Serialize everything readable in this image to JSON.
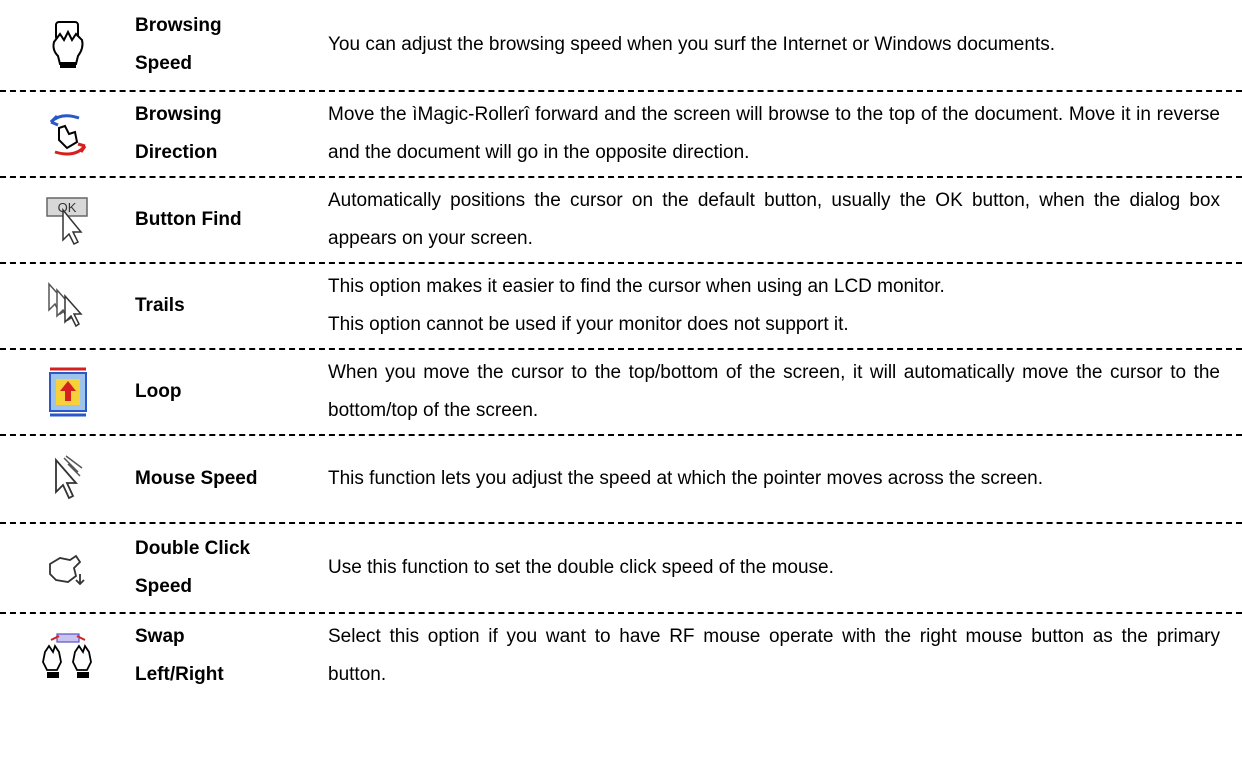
{
  "rows": [
    {
      "icon": "hand-scroll-icon",
      "name_lines": [
        "Browsing",
        "Speed"
      ],
      "description": [
        "You can adjust the browsing speed when you surf the Internet or Windows documents."
      ]
    },
    {
      "icon": "hand-direction-arrows-icon",
      "name_lines": [
        "Browsing",
        "Direction"
      ],
      "description": [
        "Move the ìMagic-Rollerî forward and the screen will browse to the top of the document. Move it in reverse and the document will go in the opposite direction."
      ]
    },
    {
      "icon": "ok-button-cursor-icon",
      "icon_text": "OK",
      "name_lines": [
        "Button Find"
      ],
      "description": [
        "Automatically positions the cursor on the default button, usually the OK button, when the dialog box appears on your screen."
      ]
    },
    {
      "icon": "cursor-trails-icon",
      "name_lines": [
        "Trails"
      ],
      "description": [
        "This option makes it easier to find the cursor when using an LCD monitor.",
        "This option cannot be used if your monitor does not support it."
      ]
    },
    {
      "icon": "screen-loop-arrows-icon",
      "name_lines": [
        "Loop"
      ],
      "description": [
        "When you move the cursor to the top/bottom of the screen, it will automatically move the cursor to the bottom/top of the screen."
      ]
    },
    {
      "icon": "pointer-speed-icon",
      "name_lines": [
        "Mouse Speed"
      ],
      "description": [
        "This function lets you adjust the speed at which the pointer moves across the screen."
      ]
    },
    {
      "icon": "hand-double-click-icon",
      "name_lines": [
        "Double Click",
        "Speed"
      ],
      "description": [
        "Use this function to set the double click speed of the mouse."
      ]
    },
    {
      "icon": "swap-hands-icon",
      "name_lines": [
        "Swap",
        "Left/Right"
      ],
      "description": [
        "Select this option if you want to have RF mouse operate with the right mouse button as the primary button."
      ]
    }
  ],
  "colors": {
    "text": "#000000",
    "divider": "#000000",
    "icon_red": "#d62020",
    "icon_blue": "#2a58c8",
    "icon_yellow": "#f5d23a"
  }
}
